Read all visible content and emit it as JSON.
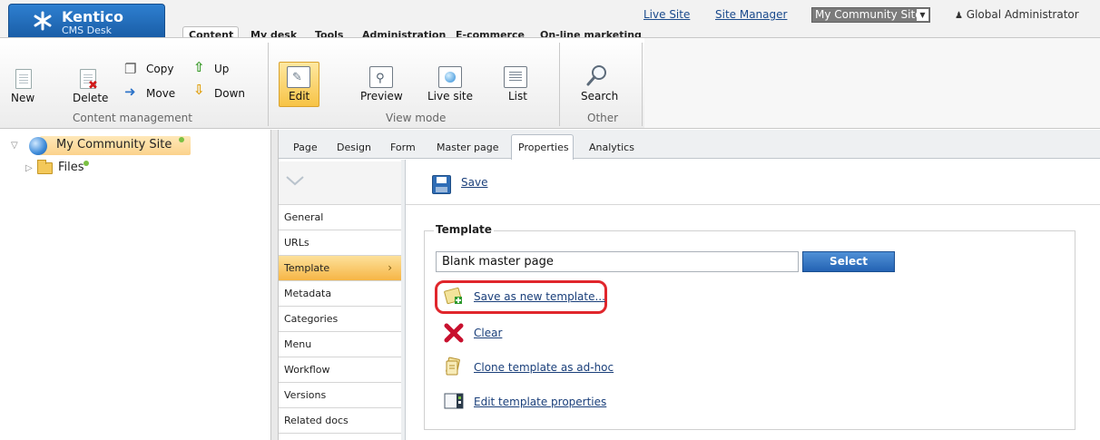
{
  "brand": {
    "name": "Kentico",
    "product": "CMS Desk"
  },
  "top_links": {
    "live_site": "Live Site",
    "site_manager": "Site Manager"
  },
  "site_selector": {
    "value": "My Community Site"
  },
  "user": {
    "name": "Global Administrator"
  },
  "main_tabs": [
    "Content",
    "My desk",
    "Tools",
    "Administration",
    "E-commerce",
    "On-line marketing"
  ],
  "ribbon": {
    "content_management": {
      "label": "Content management",
      "new": "New",
      "delete": "Delete",
      "copy": "Copy",
      "move": "Move",
      "up": "Up",
      "down": "Down"
    },
    "view_mode": {
      "label": "View mode",
      "edit": "Edit",
      "preview": "Preview",
      "live_site": "Live site",
      "list": "List"
    },
    "other": {
      "label": "Other",
      "search": "Search"
    }
  },
  "tree": {
    "root": "My Community Site",
    "child": "Files"
  },
  "sub_tabs": [
    "Page",
    "Design",
    "Form",
    "Master page",
    "Properties",
    "Analytics"
  ],
  "property_menu": [
    "General",
    "URLs",
    "Template",
    "Metadata",
    "Categories",
    "Menu",
    "Workflow",
    "Versions",
    "Related docs"
  ],
  "content": {
    "save": "Save",
    "template_legend": "Template",
    "template_value": "Blank master page",
    "select_button": "Select",
    "actions": {
      "save_new": "Save as new template...",
      "clear": "Clear",
      "clone": "Clone template as ad-hoc",
      "edit_props": "Edit template properties"
    }
  },
  "colors": {
    "accent": "#2463b3",
    "active_tab": "#f6b545",
    "highlight": "#e0262c",
    "online": "#7bc043"
  }
}
